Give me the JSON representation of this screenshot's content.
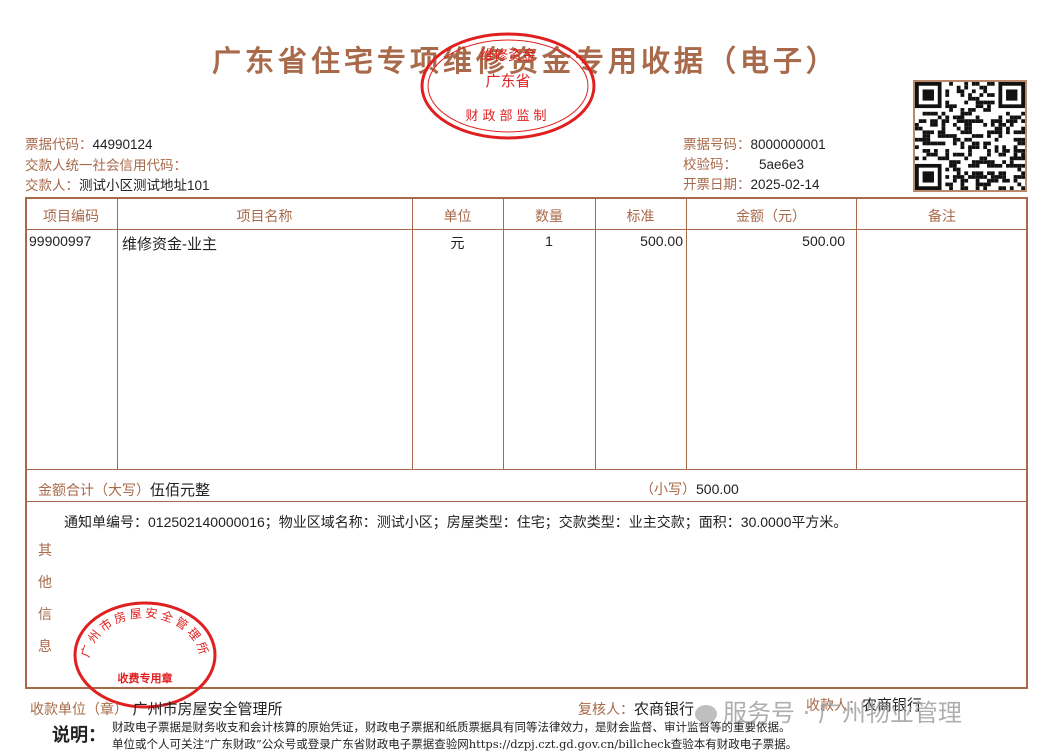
{
  "title": "广东省住宅专项维修资金专用收据（电子）",
  "stamp_top": {
    "line1": "财政部监制",
    "line2": "广东省",
    "line3": "维修资金"
  },
  "left_meta": {
    "code_label": "票据代码：",
    "code_value": "44990124",
    "credit_label": "交款人统一社会信用代码：",
    "credit_value": "",
    "payer_label": "交款人：",
    "payer_value": "测试小区测试地址101"
  },
  "right_meta": {
    "number_label": "票据号码：",
    "number_value": "8000000001",
    "check_label": "校验码：",
    "check_value": "5ae6e3",
    "date_label": "开票日期：",
    "date_value": "2025-02-14"
  },
  "table": {
    "headers": [
      "项目编码",
      "项目名称",
      "单位",
      "数量",
      "标准",
      "金额（元）",
      "备注"
    ],
    "rows": [
      {
        "code": "99900997",
        "name": "维修资金-业主",
        "unit": "元",
        "qty": "1",
        "std": "500.00",
        "amount": "500.00",
        "remark": ""
      }
    ]
  },
  "total": {
    "upper_label": "金额合计（大写）",
    "upper_value": "伍佰元整",
    "lower_label": "（小写）",
    "lower_value": "500.00"
  },
  "other": {
    "label": "其他信息",
    "text": "通知单编号：012502140000016；物业区域名称：测试小区；房屋类型：住宅；交款类型：业主交款；面积：30.0000平方米。"
  },
  "stamp_bottom": {
    "ring": "广州市房屋安全管理所",
    "center": "收费专用章"
  },
  "footer": {
    "unit_label": "收款单位（章）",
    "unit_value": "广州市房屋安全管理所",
    "reviewer_label": "复核人：",
    "reviewer_value": "农商银行",
    "collector_label": "收款人：",
    "collector_value": "农商银行"
  },
  "notes": {
    "label": "说明：",
    "line1": "财政电子票据是财务收支和会计核算的原始凭证，财政电子票据和纸质票据具有同等法律效力，是财会监督、审计监督等的重要依据。",
    "line2": "单位或个人可关注“广东财政”公众号或登录广东省财政电子票据查验网https://dzpj.czt.gd.gov.cn/billcheck查验本有财政电子票据。"
  },
  "watermark": "服务号 · 广州物业管理",
  "colors": {
    "accent": "#a86a4a",
    "stamp": "#e02020"
  }
}
